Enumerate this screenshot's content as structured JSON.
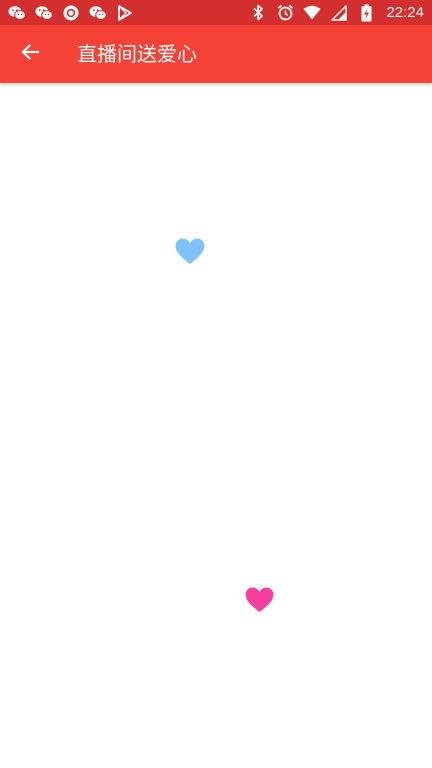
{
  "status_bar": {
    "time": "22:24",
    "icons_left": [
      "wechat-icon",
      "wechat-icon",
      "circle-app-icon",
      "wechat-icon",
      "play-store-icon"
    ],
    "icons_right": [
      "bluetooth-icon",
      "alarm-icon",
      "wifi-icon",
      "cell-signal-icon",
      "battery-charging-icon"
    ],
    "background_color": "#d32f2f"
  },
  "app_bar": {
    "title": "直播间送爱心",
    "back_icon": "arrow-back-icon",
    "background_color": "#f44336"
  },
  "hearts": [
    {
      "icon": "heart-icon",
      "color": "#7ec3fb"
    },
    {
      "icon": "heart-icon",
      "color": "#f83ea1"
    }
  ]
}
